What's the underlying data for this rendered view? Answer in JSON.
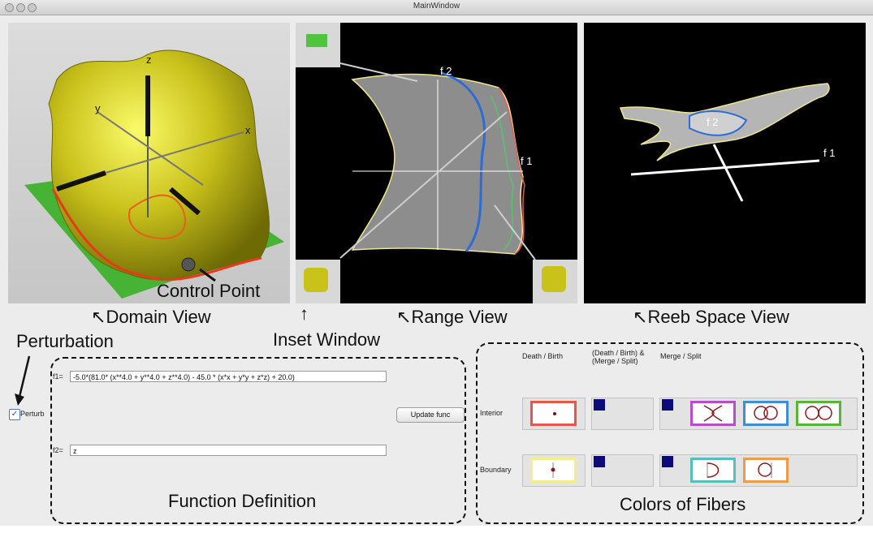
{
  "window": {
    "title": "MainWindow"
  },
  "views": {
    "domain": {
      "axes": {
        "x": "x",
        "y": "y",
        "z": "z"
      },
      "control_point_label": "Control Point",
      "caption": "Domain View"
    },
    "range": {
      "axes": {
        "f1": "f 1",
        "f2": "f 2"
      },
      "caption": "Range View",
      "inset_caption": "Inset Window"
    },
    "reeb": {
      "axes": {
        "f1": "f 1",
        "f2": "f 2"
      },
      "caption": "Reeb Space View"
    }
  },
  "perturb": {
    "annotation": "Perturbation",
    "checkbox_label": "Perturb",
    "checked": true
  },
  "function_definition": {
    "caption": "Function Definition",
    "f1_label": "f1=",
    "f1_value": "-5.0*(81.0* (x**4.0 + y**4.0 + z**4.0) - 45.0 * (x*x + y*y + z*z) + 20.0)",
    "f2_label": "f2=",
    "f2_value": "z",
    "update_button": "Update func"
  },
  "fiber_colors": {
    "caption": "Colors of Fibers",
    "headers": [
      "Death / Birth",
      "(Death / Birth) & (Merge / Split)",
      "Merge / Split"
    ],
    "rows": [
      "Interior",
      "Boundary"
    ],
    "colors": {
      "death_birth_interior": "#e8554a",
      "death_birth_boundary": "#f2ee8a",
      "merge_interior_1": "#b64ec8",
      "merge_interior_2": "#3a8fd6",
      "merge_interior_3": "#58b534",
      "merge_boundary_1": "#55c0bb",
      "merge_boundary_2": "#ef9a45",
      "marker": "#0b0b7a"
    }
  }
}
